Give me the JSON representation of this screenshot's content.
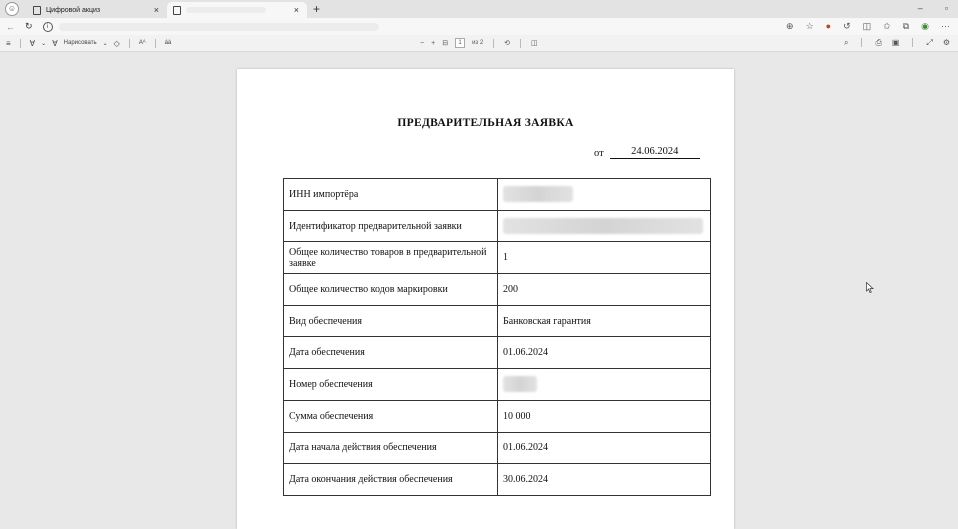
{
  "browser": {
    "tabs": [
      {
        "title": "Цифровой акциз",
        "active": false
      },
      {
        "title": "",
        "active": true
      }
    ]
  },
  "pdf_toolbar": {
    "draw_label": "Нарисовать",
    "text_label": "Aᴬ",
    "read_label": "áà",
    "zoom_out": "−",
    "zoom_in": "+",
    "page_current": "1",
    "page_total": "из 2"
  },
  "document": {
    "title": "ПРЕДВАРИТЕЛЬНАЯ ЗАЯВКА",
    "date_prefix": "от",
    "date": "24.06.2024",
    "rows": [
      {
        "label": "ИНН импортёра",
        "value": ""
      },
      {
        "label": "Идентификатор предварительной заявки",
        "value": ""
      },
      {
        "label": "Общее количество товаров в предварительной заявке",
        "value": "1"
      },
      {
        "label": "Общее количество кодов маркировки",
        "value": "200"
      },
      {
        "label": "Вид обеспечения",
        "value": "Банковская гарантия"
      },
      {
        "label": "Дата обеспечения",
        "value": "01.06.2024"
      },
      {
        "label": "Номер обеспечения",
        "value": ""
      },
      {
        "label": "Сумма обеспечения",
        "value": "10 000"
      },
      {
        "label": "Дата начала действия обеспечения",
        "value": "01.06.2024"
      },
      {
        "label": "Дата окончания действия обеспечения",
        "value": "30.06.2024"
      }
    ]
  }
}
